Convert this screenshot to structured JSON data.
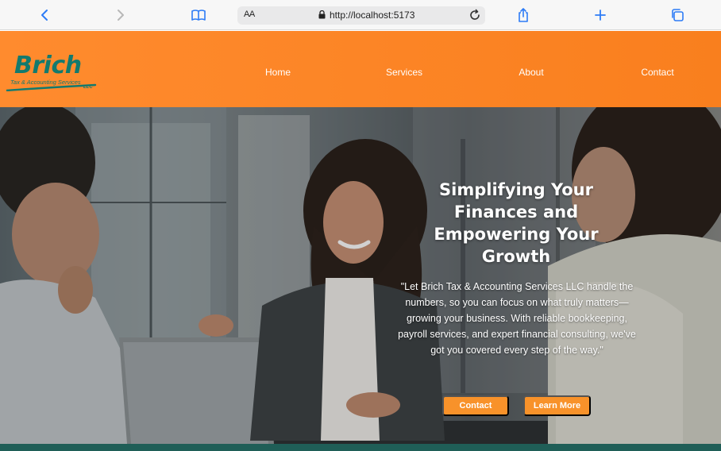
{
  "browser": {
    "text_size_label": "AA",
    "url": "http://localhost:5173",
    "icons": [
      "back-icon",
      "forward-icon",
      "reader-icon",
      "lock-icon",
      "reload-icon",
      "share-icon",
      "new-tab-icon",
      "tabs-icon"
    ]
  },
  "header": {
    "logo": {
      "word": "Brich",
      "tagline": "Tax & Accounting Services",
      "suffix": "LLC"
    },
    "nav": [
      "Home",
      "Services",
      "About",
      "Contact"
    ]
  },
  "hero": {
    "title": "Simplifying Your Finances and Empowering Your Growth",
    "text": "\"Let Brich Tax & Accounting Services LLC handle the numbers, so you can focus on what truly matters—growing your business. With reliable bookkeeping, payroll services, and expert financial consulting, we've got you covered every step of the way.\"",
    "buttons": {
      "contact": "Contact",
      "learn_more": "Learn More"
    }
  },
  "colors": {
    "header_orange": "#ff8b2e",
    "brand_teal": "#137a6e",
    "button_orange": "#f8922a",
    "footer_teal": "#1f5e57"
  }
}
